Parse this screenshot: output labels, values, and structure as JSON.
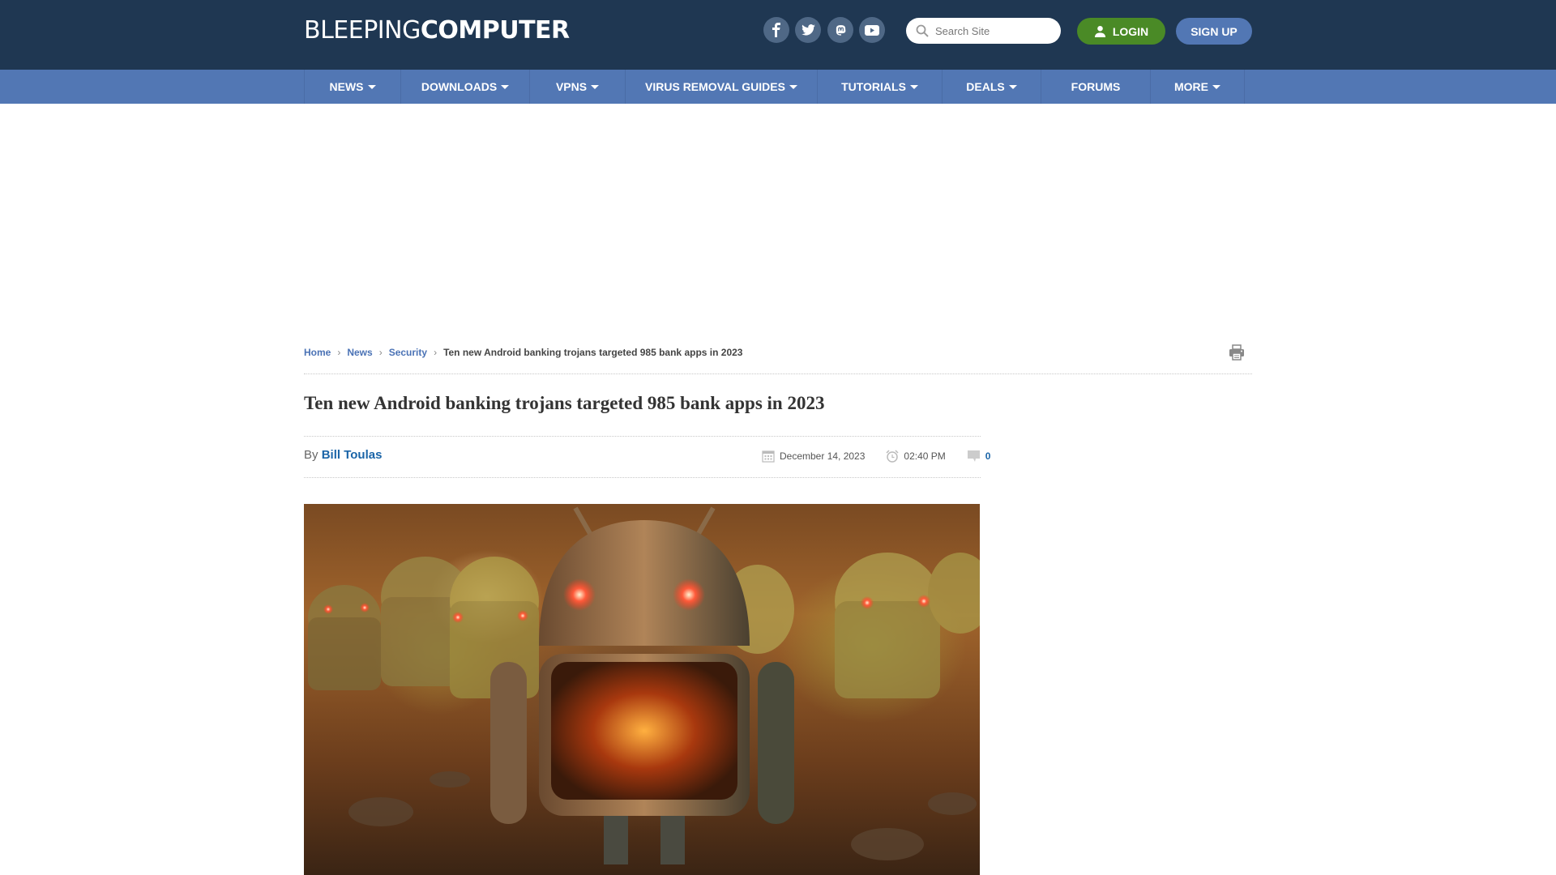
{
  "header": {
    "logo_light": "BLEEPING",
    "logo_bold": "COMPUTER",
    "social": [
      {
        "name": "facebook-icon",
        "label": "Facebook"
      },
      {
        "name": "twitter-icon",
        "label": "Twitter"
      },
      {
        "name": "mastodon-icon",
        "label": "Mastodon"
      },
      {
        "name": "youtube-icon",
        "label": "YouTube"
      }
    ],
    "search_placeholder": "Search Site",
    "login_label": "LOGIN",
    "signup_label": "SIGN UP"
  },
  "nav": {
    "items": [
      {
        "label": "NEWS",
        "dropdown": true
      },
      {
        "label": "DOWNLOADS",
        "dropdown": true
      },
      {
        "label": "VPNS",
        "dropdown": true
      },
      {
        "label": "VIRUS REMOVAL GUIDES",
        "dropdown": true
      },
      {
        "label": "TUTORIALS",
        "dropdown": true
      },
      {
        "label": "DEALS",
        "dropdown": true
      },
      {
        "label": "FORUMS",
        "dropdown": false
      },
      {
        "label": "MORE",
        "dropdown": true
      }
    ]
  },
  "breadcrumb": {
    "items": [
      "Home",
      "News",
      "Security"
    ],
    "current": "Ten new Android banking trojans targeted 985 bank apps in 2023"
  },
  "article": {
    "title": "Ten new Android banking trojans targeted 985 bank apps in 2023",
    "by_label": "By",
    "author": "Bill Toulas",
    "date": "December 14, 2023",
    "time": "02:40 PM",
    "comments": "0",
    "hero_alt": "Rusty Android robot with glowing red eyes among other Android robots"
  },
  "colors": {
    "header_bg": "#1f3752",
    "nav_bg": "#5277b4",
    "login_bg": "#4a8a26",
    "link": "#1b65a8"
  }
}
